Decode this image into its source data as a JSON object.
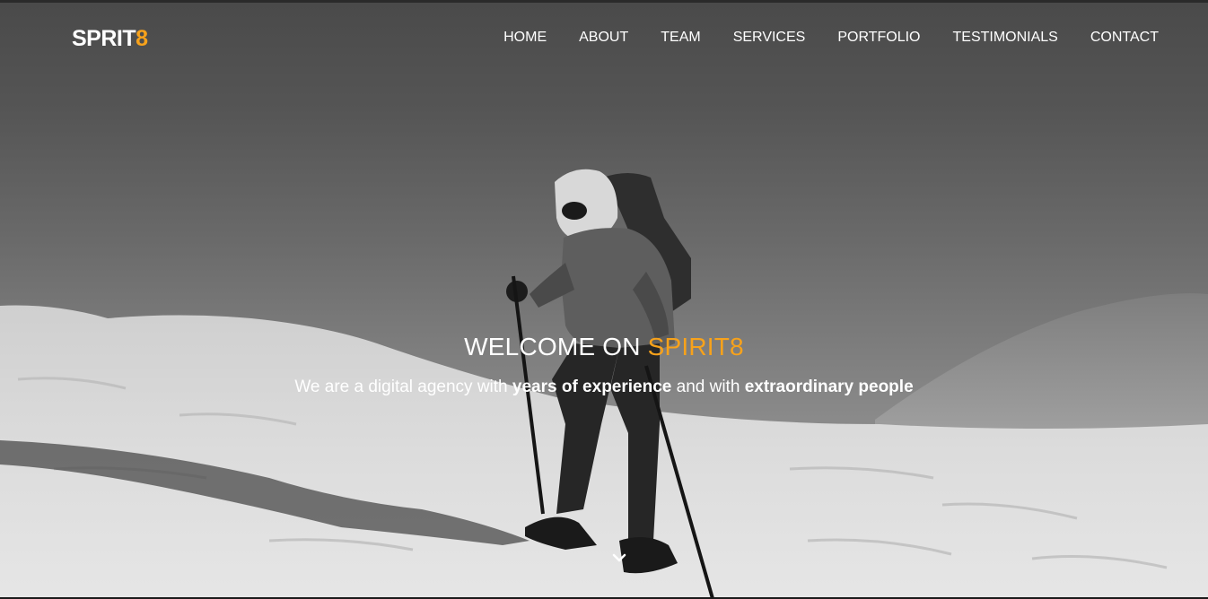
{
  "brand": {
    "name_main": "SPRIT",
    "name_accent": "8"
  },
  "nav": {
    "items": [
      {
        "label": "HOME"
      },
      {
        "label": "ABOUT"
      },
      {
        "label": "TEAM"
      },
      {
        "label": "SERVICES"
      },
      {
        "label": "PORTFOLIO"
      },
      {
        "label": "TESTIMONIALS"
      },
      {
        "label": "CONTACT"
      }
    ]
  },
  "hero": {
    "welcome_prefix": "WELCOME ON ",
    "welcome_accent": "SPIRIT8",
    "tagline_part1": "We are a digital agency with ",
    "tagline_bold1": "years of experience",
    "tagline_part2": " and with ",
    "tagline_bold2": "extraordinary people",
    "scroll_icon": "chevron-down-icon"
  },
  "colors": {
    "accent": "#f7a21b",
    "text": "#ffffff"
  }
}
